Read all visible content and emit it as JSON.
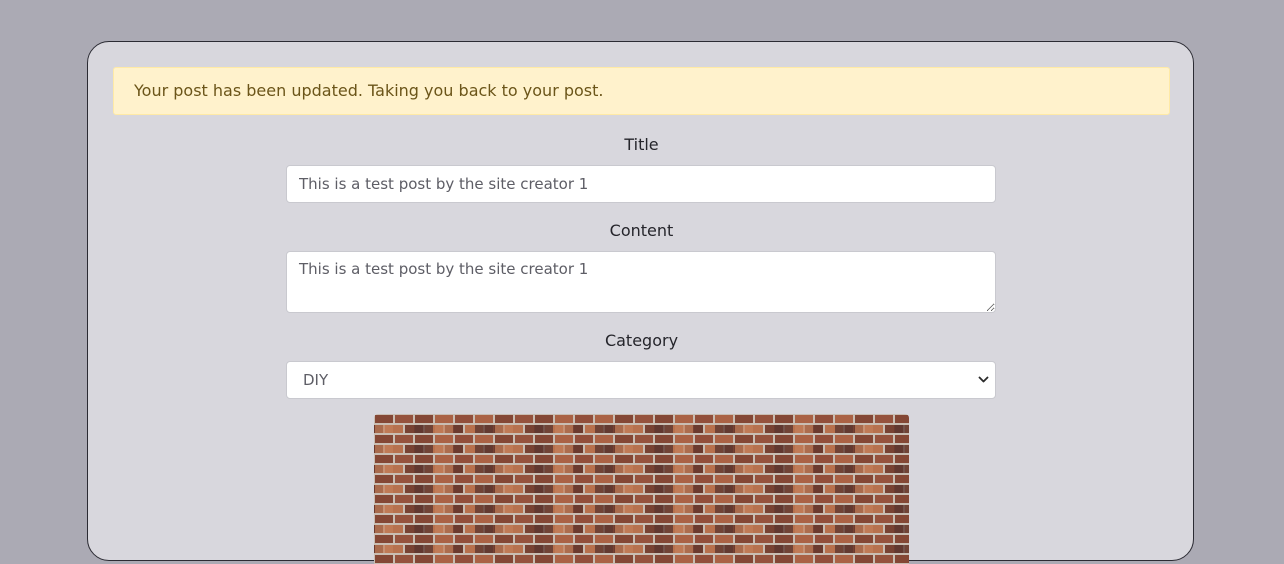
{
  "alert": {
    "message": "Your post has been updated. Taking you back to your post."
  },
  "form": {
    "title_label": "Title",
    "title_value": "This is a test post by the site creator 1",
    "content_label": "Content",
    "content_value": "This is a test post by the site creator 1",
    "category_label": "Category",
    "category_selected": "DIY"
  },
  "icons": {
    "select_arrow": "chevron-down-icon",
    "post_image": "brick-wall-image"
  },
  "colors": {
    "page_background": "#abaab4",
    "card_background": "#d8d7dd",
    "alert_background": "#fff2cc",
    "alert_text": "#6b5519"
  }
}
